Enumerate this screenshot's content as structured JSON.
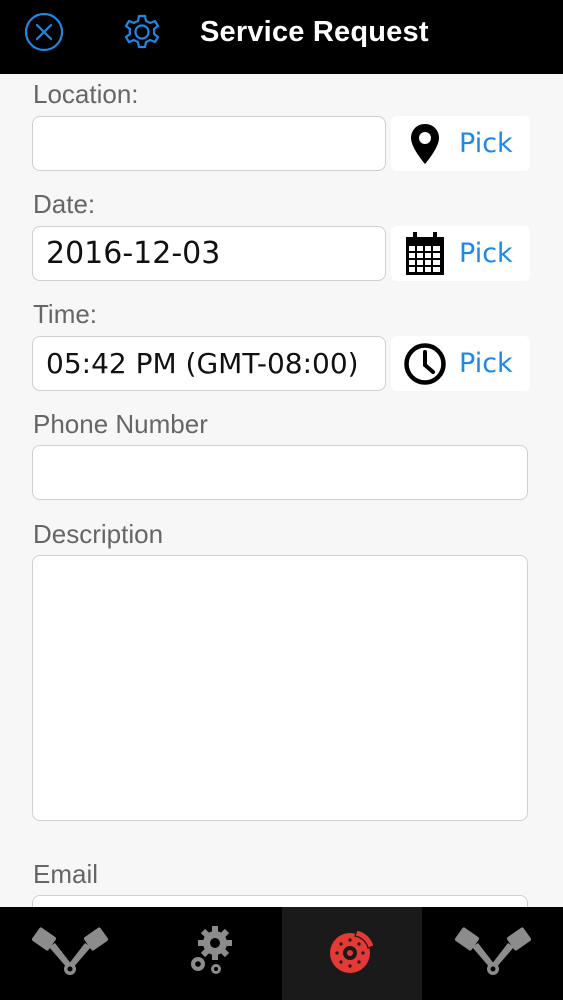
{
  "header": {
    "title": "Service Request",
    "close_icon": "close-circle-icon",
    "settings_icon": "gear-icon",
    "accent_color": "#1e88e5"
  },
  "form": {
    "location": {
      "label": "Location:",
      "value": "",
      "pick_label": "Pick",
      "icon": "map-pin-icon"
    },
    "date": {
      "label": "Date:",
      "value": "2016-12-03",
      "pick_label": "Pick",
      "icon": "calendar-icon"
    },
    "time": {
      "label": "Time:",
      "value": "05:42 PM (GMT-08:00)",
      "pick_label": "Pick",
      "icon": "clock-icon"
    },
    "phone": {
      "label": "Phone Number",
      "value": ""
    },
    "description": {
      "label": "Description",
      "value": ""
    },
    "email": {
      "label": "Email",
      "value": ""
    }
  },
  "tabbar": {
    "tabs": [
      {
        "icon": "pistons-icon",
        "active": false
      },
      {
        "icon": "gears-icon",
        "active": false
      },
      {
        "icon": "brake-disc-icon",
        "active": true,
        "color": "#e53935"
      },
      {
        "icon": "pistons-icon",
        "active": false
      }
    ]
  }
}
